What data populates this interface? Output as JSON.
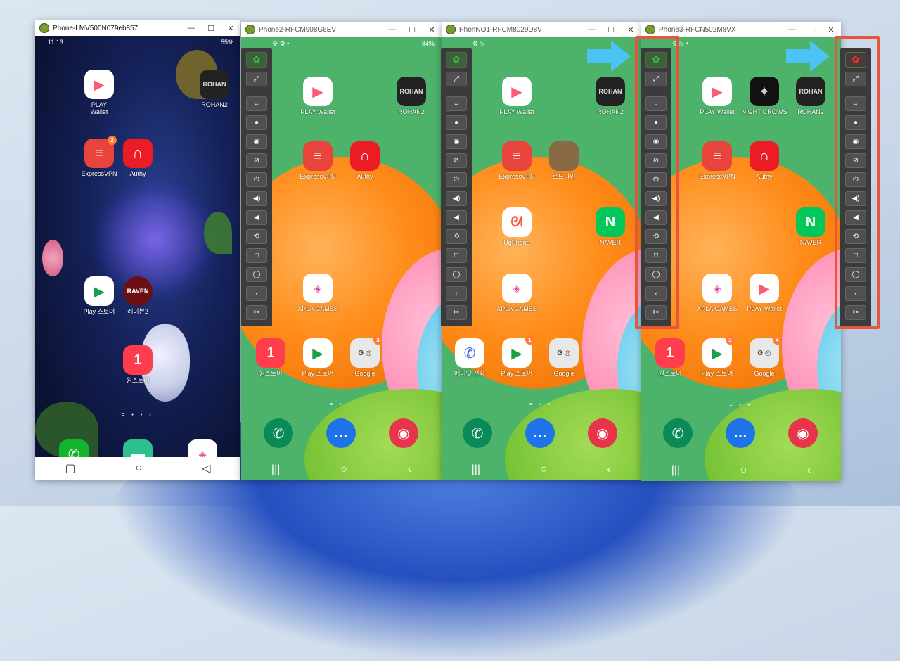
{
  "windows": {
    "w1": {
      "title": "Phone-LMV500N079eb857",
      "time": "11:13",
      "battery": "55%"
    },
    "w2": {
      "title": "Phone2-RFCM908G6EV",
      "battery": "84%"
    },
    "w3": {
      "title": "PhonNO1-RFCM8029D8V"
    },
    "w4": {
      "title": "Phone3-RFCN502M8VX"
    }
  },
  "apps": {
    "play_wallet": "PLAY\nWallet",
    "play_wallet_one": "PLAY Wallet",
    "rohan2": "ROHAN2",
    "expressvpn": "ExpressVPN",
    "authy": "Authy",
    "playstore_kr": "Play 스토어",
    "raven2": "레이븐2",
    "onestore": "원스토어",
    "xpla": "XPLA GAMES",
    "google": "Google",
    "ugphone": "UgPhone",
    "naver": "NAVER",
    "lordnine": "로드나인",
    "lordnine_partial": "인",
    "nightcrows": "NIGHT CROWS",
    "samsung_phone": "에이닷 전화"
  },
  "badges": {
    "expressvpn_lg": "2",
    "google": "3",
    "playstore": "1",
    "google_w4": "4"
  },
  "toolbar_icons": [
    "bug-icon",
    "fullscreen-icon",
    "collapse-icon",
    "record-icon",
    "eye-icon",
    "eye-off-icon",
    "power-icon",
    "volume-up-icon",
    "volume-down-icon",
    "rotate-icon",
    "home-icon",
    "recents-icon",
    "back-icon",
    "scissors-icon"
  ],
  "colors": {
    "highlight": "#e8553d",
    "arrow": "#4cc3f5",
    "toolbar": "#3b3b3b"
  }
}
